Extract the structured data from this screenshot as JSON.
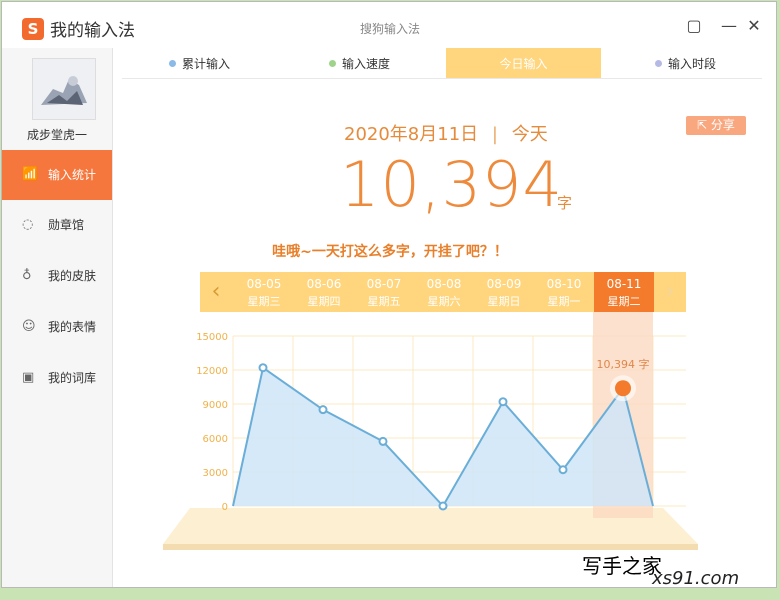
{
  "app": {
    "title": "我的输入法",
    "window_title": "搜狗输入法",
    "logo": "S"
  },
  "window_controls": {
    "feedback": "▢",
    "minimize": "—",
    "close": "✕"
  },
  "user": {
    "name": "成步堂虎一"
  },
  "sidebar": {
    "items": [
      {
        "label": "输入统计",
        "icon": "chart-icon",
        "glyph": "📶",
        "active": true
      },
      {
        "label": "勋章馆",
        "icon": "medal-icon",
        "glyph": "◌"
      },
      {
        "label": "我的皮肤",
        "icon": "shirt-icon",
        "glyph": "♁"
      },
      {
        "label": "我的表情",
        "icon": "smiley-icon",
        "glyph": "☺"
      },
      {
        "label": "我的词库",
        "icon": "book-icon",
        "glyph": "▣"
      }
    ]
  },
  "tabs": [
    {
      "label": "累计输入",
      "dot": "#8bb9e8"
    },
    {
      "label": "输入速度",
      "dot": "#9fd38c"
    },
    {
      "label": "今日输入",
      "dot": "#ffd57d",
      "active": true
    },
    {
      "label": "输入时段",
      "dot": "#b7b9e5"
    }
  ],
  "today": {
    "date": "2020年8月11日",
    "sep": "|",
    "label": "今天",
    "count": "10,394",
    "unit": "字",
    "share": "分享",
    "message": "哇哦~一天打这么多字，开挂了吧？！"
  },
  "days": [
    {
      "date": "08-05",
      "weekday": "星期三"
    },
    {
      "date": "08-06",
      "weekday": "星期四"
    },
    {
      "date": "08-07",
      "weekday": "星期五"
    },
    {
      "date": "08-08",
      "weekday": "星期六"
    },
    {
      "date": "08-09",
      "weekday": "星期日"
    },
    {
      "date": "08-10",
      "weekday": "星期一"
    },
    {
      "date": "08-11",
      "weekday": "星期二",
      "active": true
    }
  ],
  "arrows": {
    "prev": "‹",
    "next": "›"
  },
  "chart_data": {
    "type": "area",
    "categories": [
      "08-05",
      "08-06",
      "08-07",
      "08-08",
      "08-09",
      "08-10",
      "08-11"
    ],
    "values": [
      12200,
      8500,
      5700,
      0,
      9200,
      3200,
      10394
    ],
    "yticks": [
      0,
      3000,
      6000,
      9000,
      12000,
      15000
    ],
    "ylim": [
      0,
      15000
    ],
    "highlight_label": "10,394 字",
    "colors": {
      "line": "#6aaed8",
      "fill": "#cfe5f7",
      "highlight": "#f37b2b",
      "tick": "#f0b24a"
    }
  },
  "watermark": {
    "text1": "写手之家",
    "text2": "xs91.com"
  }
}
